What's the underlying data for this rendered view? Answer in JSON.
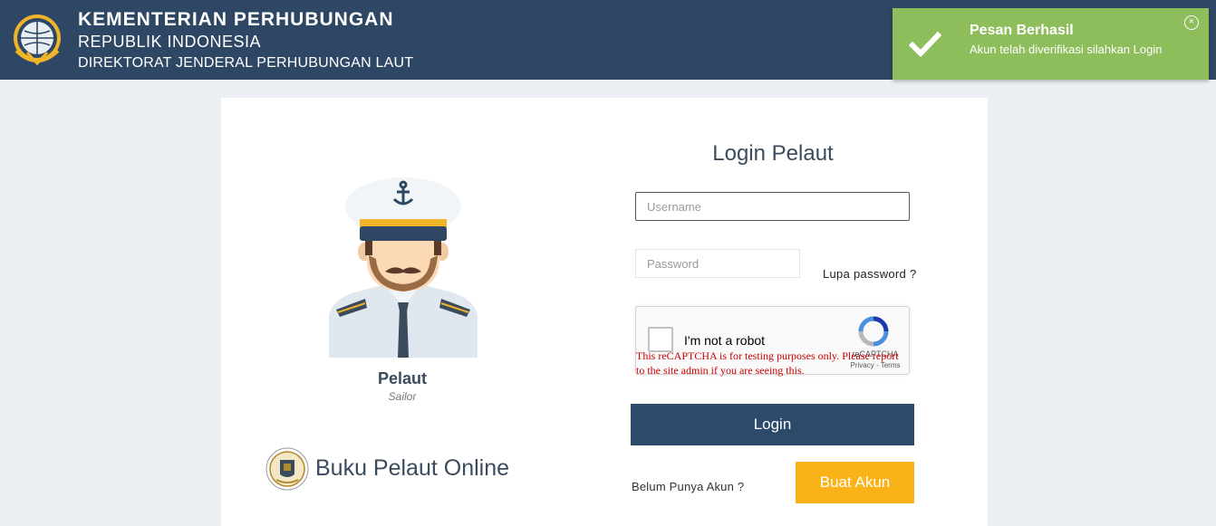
{
  "header": {
    "line1": "KEMENTERIAN PERHUBUNGAN",
    "line2": "REPUBLIK INDONESIA",
    "line3": "DIREKTORAT JENDERAL PERHUBUNGAN LAUT",
    "logo_icon": "ministry-logo-icon",
    "bg_color": "#2e4764"
  },
  "toast": {
    "title": "Pesan Berhasil",
    "message": "Akun telah diverifikasi silahkan Login",
    "close_glyph": "×",
    "icon": "check-icon",
    "bg_color": "#8ebd5b"
  },
  "left": {
    "sailor_title": "Pelaut",
    "sailor_subtitle": "Sailor",
    "brand": "Buku Pelaut Online",
    "seal_icon": "seal-logo-icon"
  },
  "login": {
    "title": "Login Pelaut",
    "username_placeholder": "Username",
    "password_placeholder": "Password",
    "forgot": "Lupa password ?",
    "captcha_label": "I'm not a robot",
    "captcha_brand": "reCAPTCHA",
    "captcha_links": "Privacy - Terms",
    "captcha_warning": "This reCAPTCHA is for testing purposes only. Please report to the site admin if you are seeing this.",
    "login_button": "Login",
    "no_account": "Belum Punya Akun ?",
    "create_button": "Buat Akun",
    "primary_color": "#2e4a6b",
    "accent_color": "#f9b318"
  }
}
